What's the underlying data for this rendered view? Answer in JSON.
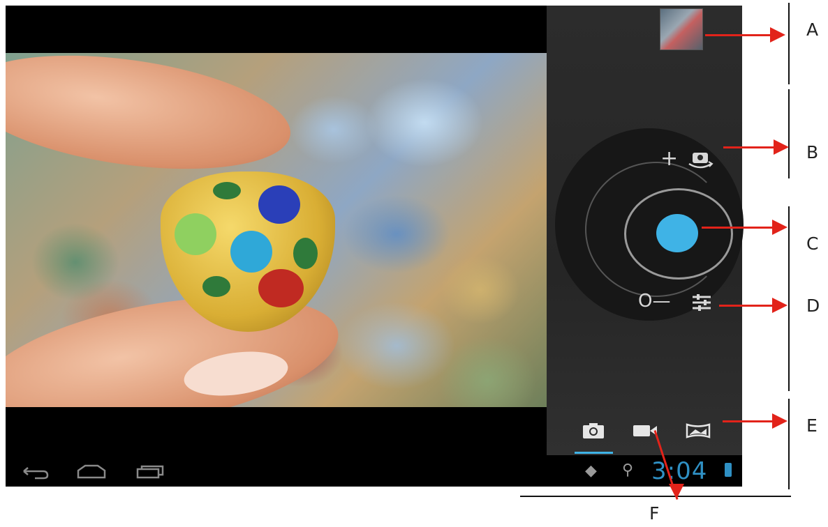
{
  "status_bar": {
    "time": "3:04"
  },
  "controls": {
    "zoom_in": "+",
    "zoom_out": "O—",
    "settings_icon": "settings-sliders-icon",
    "camera_switch_icon": "camera-switch-icon"
  },
  "modes": [
    {
      "name": "camera",
      "icon": "camera-icon",
      "selected": true
    },
    {
      "name": "video",
      "icon": "video-icon",
      "selected": false
    },
    {
      "name": "panorama",
      "icon": "panorama-icon",
      "selected": false
    }
  ],
  "callouts": [
    "A",
    "B",
    "C",
    "D",
    "E",
    "F"
  ],
  "colors": {
    "accent": "#3fb3e6",
    "arrow": "#e2231a",
    "panel": "#2b2b2b"
  }
}
